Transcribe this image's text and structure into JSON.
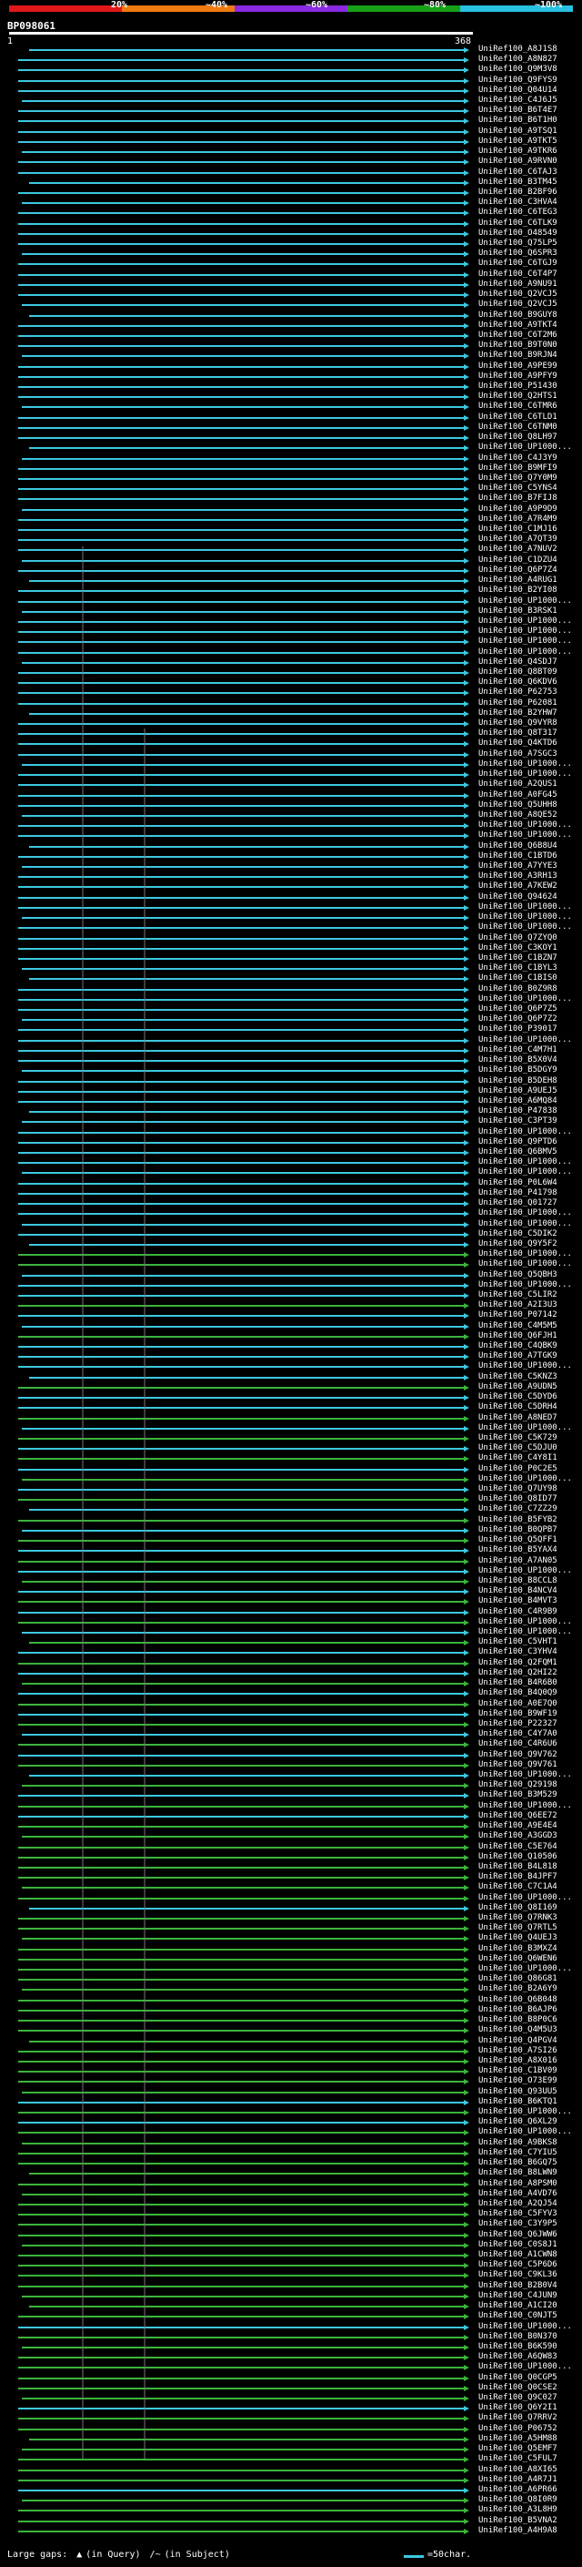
{
  "header": {
    "title": "BP098061",
    "scale_labels": [
      "20%",
      "~40%",
      "~60%",
      "~80%",
      "~100%"
    ],
    "scale_colors": [
      "#e01818",
      "#f07a10",
      "#8a2be2",
      "#18a018",
      "#2ac0e0"
    ],
    "query_start": "1",
    "query_end": "368"
  },
  "colors": {
    "high_identity": "#3cc8e0",
    "medium_identity": "#3cb43c",
    "gap_marker": "#777777"
  },
  "hits": [
    {
      "label": "UniRef100_A8J1S8",
      "color": "cyan"
    },
    {
      "label": "UniRef100_A8N827",
      "color": "cyan"
    },
    {
      "label": "UniRef100_Q9M3V8",
      "color": "cyan"
    },
    {
      "label": "UniRef100_Q9FYS9",
      "color": "cyan"
    },
    {
      "label": "UniRef100_Q04U14",
      "color": "cyan"
    },
    {
      "label": "UniRef100_C4J6J5",
      "color": "cyan"
    },
    {
      "label": "UniRef100_B6T4E7",
      "color": "cyan"
    },
    {
      "label": "UniRef100_B6T1H0",
      "color": "cyan"
    },
    {
      "label": "UniRef100_A9TSQ1",
      "color": "cyan"
    },
    {
      "label": "UniRef100_A9TKT5",
      "color": "cyan"
    },
    {
      "label": "UniRef100_A9TKR6",
      "color": "cyan"
    },
    {
      "label": "UniRef100_A9RVN0",
      "color": "cyan"
    },
    {
      "label": "UniRef100_C6TAJ3",
      "color": "cyan"
    },
    {
      "label": "UniRef100_B3TM45",
      "color": "cyan"
    },
    {
      "label": "UniRef100_B2BF96",
      "color": "cyan"
    },
    {
      "label": "UniRef100_C3HVA4",
      "color": "cyan"
    },
    {
      "label": "UniRef100_C6TEG3",
      "color": "cyan"
    },
    {
      "label": "UniRef100_C6TLK9",
      "color": "cyan"
    },
    {
      "label": "UniRef100_O48549",
      "color": "cyan"
    },
    {
      "label": "UniRef100_Q75LP5",
      "color": "cyan"
    },
    {
      "label": "UniRef100_Q6SPR3",
      "color": "cyan"
    },
    {
      "label": "UniRef100_C6TGJ9",
      "color": "cyan"
    },
    {
      "label": "UniRef100_C6T4P7",
      "color": "cyan"
    },
    {
      "label": "UniRef100_A9NU91",
      "color": "cyan"
    },
    {
      "label": "UniRef100_Q2VCJ5",
      "color": "cyan"
    },
    {
      "label": "UniRef100_Q2VCJ5",
      "color": "cyan"
    },
    {
      "label": "UniRef100_B9GUY8",
      "color": "cyan"
    },
    {
      "label": "UniRef100_A9TKT4",
      "color": "cyan"
    },
    {
      "label": "UniRef100_C6T2M6",
      "color": "cyan"
    },
    {
      "label": "UniRef100_B9T0N0",
      "color": "cyan"
    },
    {
      "label": "UniRef100_B9RJN4",
      "color": "cyan"
    },
    {
      "label": "UniRef100_A9PE99",
      "color": "cyan"
    },
    {
      "label": "UniRef100_A9PFY9",
      "color": "cyan"
    },
    {
      "label": "UniRef100_P51430",
      "color": "cyan"
    },
    {
      "label": "UniRef100_Q2HTS1",
      "color": "cyan"
    },
    {
      "label": "UniRef100_C6TMR6",
      "color": "cyan"
    },
    {
      "label": "UniRef100_C6TLD1",
      "color": "cyan"
    },
    {
      "label": "UniRef100_C6TNM0",
      "color": "cyan"
    },
    {
      "label": "UniRef100_Q8LH97",
      "color": "cyan"
    },
    {
      "label": "UniRef100_UP1000...",
      "color": "cyan"
    },
    {
      "label": "UniRef100_C4J3Y9",
      "color": "cyan"
    },
    {
      "label": "UniRef100_B9MFI9",
      "color": "cyan"
    },
    {
      "label": "UniRef100_Q7Y0M9",
      "color": "cyan"
    },
    {
      "label": "UniRef100_C5YNS4",
      "color": "cyan"
    },
    {
      "label": "UniRef100_B7FIJ8",
      "color": "cyan"
    },
    {
      "label": "UniRef100_A9P9D9",
      "color": "cyan"
    },
    {
      "label": "UniRef100_A7R4M9",
      "color": "cyan"
    },
    {
      "label": "UniRef100_C1MJ16",
      "color": "cyan"
    },
    {
      "label": "UniRef100_A7QT39",
      "color": "cyan"
    },
    {
      "label": "UniRef100_A7NUV2",
      "color": "cyan"
    },
    {
      "label": "UniRef100_C1DZU4",
      "color": "cyan"
    },
    {
      "label": "UniRef100_Q6P7Z4",
      "color": "cyan"
    },
    {
      "label": "UniRef100_A4RUG1",
      "color": "cyan"
    },
    {
      "label": "UniRef100_B2YI08",
      "color": "cyan"
    },
    {
      "label": "UniRef100_UP1000...",
      "color": "cyan"
    },
    {
      "label": "UniRef100_B3RSK1",
      "color": "cyan"
    },
    {
      "label": "UniRef100_UP1000...",
      "color": "cyan"
    },
    {
      "label": "UniRef100_UP1000...",
      "color": "cyan"
    },
    {
      "label": "UniRef100_UP1000...",
      "color": "cyan"
    },
    {
      "label": "UniRef100_UP1000...",
      "color": "cyan"
    },
    {
      "label": "UniRef100_Q4SDJ7",
      "color": "cyan"
    },
    {
      "label": "UniRef100_Q8BT09",
      "color": "cyan"
    },
    {
      "label": "UniRef100_Q6KDV6",
      "color": "cyan"
    },
    {
      "label": "UniRef100_P62753",
      "color": "cyan"
    },
    {
      "label": "UniRef100_P62081",
      "color": "cyan"
    },
    {
      "label": "UniRef100_B2YHW7",
      "color": "cyan"
    },
    {
      "label": "UniRef100_Q9VYR8",
      "color": "cyan"
    },
    {
      "label": "UniRef100_Q8T317",
      "color": "cyan"
    },
    {
      "label": "UniRef100_Q4KTD6",
      "color": "cyan"
    },
    {
      "label": "UniRef100_A7SGC3",
      "color": "cyan"
    },
    {
      "label": "UniRef100_UP1000...",
      "color": "cyan"
    },
    {
      "label": "UniRef100_UP1000...",
      "color": "cyan"
    },
    {
      "label": "UniRef100_A2QUS1",
      "color": "cyan"
    },
    {
      "label": "UniRef100_A0FG45",
      "color": "cyan"
    },
    {
      "label": "UniRef100_Q5UHH8",
      "color": "cyan"
    },
    {
      "label": "UniRef100_A8QE52",
      "color": "cyan"
    },
    {
      "label": "UniRef100_UP1000...",
      "color": "cyan"
    },
    {
      "label": "UniRef100_UP1000...",
      "color": "cyan"
    },
    {
      "label": "UniRef100_Q6B8U4",
      "color": "cyan"
    },
    {
      "label": "UniRef100_C1BTD6",
      "color": "cyan"
    },
    {
      "label": "UniRef100_A7YYE3",
      "color": "cyan"
    },
    {
      "label": "UniRef100_A3RH13",
      "color": "cyan"
    },
    {
      "label": "UniRef100_A7KEW2",
      "color": "cyan"
    },
    {
      "label": "UniRef100_Q94624",
      "color": "cyan"
    },
    {
      "label": "UniRef100_UP1000...",
      "color": "cyan"
    },
    {
      "label": "UniRef100_UP1000...",
      "color": "cyan"
    },
    {
      "label": "UniRef100_UP1000...",
      "color": "cyan"
    },
    {
      "label": "UniRef100_Q7ZYQ0",
      "color": "cyan"
    },
    {
      "label": "UniRef100_C3KOY1",
      "color": "cyan"
    },
    {
      "label": "UniRef100_C1BZN7",
      "color": "cyan"
    },
    {
      "label": "UniRef100_C1BYL3",
      "color": "cyan"
    },
    {
      "label": "UniRef100_C1BIS0",
      "color": "cyan"
    },
    {
      "label": "UniRef100_B0Z9R8",
      "color": "cyan"
    },
    {
      "label": "UniRef100_UP1000...",
      "color": "cyan"
    },
    {
      "label": "UniRef100_Q6P7Z5",
      "color": "cyan"
    },
    {
      "label": "UniRef100_Q6P7Z2",
      "color": "cyan"
    },
    {
      "label": "UniRef100_P39017",
      "color": "cyan"
    },
    {
      "label": "UniRef100_UP1000...",
      "color": "cyan"
    },
    {
      "label": "UniRef100_C4M7H1",
      "color": "cyan"
    },
    {
      "label": "UniRef100_B5X0V4",
      "color": "cyan"
    },
    {
      "label": "UniRef100_B5DGY9",
      "color": "cyan"
    },
    {
      "label": "UniRef100_B5DEH8",
      "color": "cyan"
    },
    {
      "label": "UniRef100_A9UEJ5",
      "color": "cyan"
    },
    {
      "label": "UniRef100_A6MQ84",
      "color": "cyan"
    },
    {
      "label": "UniRef100_P47838",
      "color": "cyan"
    },
    {
      "label": "UniRef100_C3PT39",
      "color": "cyan"
    },
    {
      "label": "UniRef100_UP1000...",
      "color": "cyan"
    },
    {
      "label": "UniRef100_Q9PTD6",
      "color": "cyan"
    },
    {
      "label": "UniRef100_Q6BMV5",
      "color": "cyan"
    },
    {
      "label": "UniRef100_UP1000...",
      "color": "cyan"
    },
    {
      "label": "UniRef100_UP1000...",
      "color": "cyan"
    },
    {
      "label": "UniRef100_P0L6W4",
      "color": "cyan"
    },
    {
      "label": "UniRef100_P41798",
      "color": "cyan"
    },
    {
      "label": "UniRef100_Q01727",
      "color": "cyan"
    },
    {
      "label": "UniRef100_UP1000...",
      "color": "cyan"
    },
    {
      "label": "UniRef100_UP1000...",
      "color": "cyan"
    },
    {
      "label": "UniRef100_C5DIK2",
      "color": "cyan"
    },
    {
      "label": "UniRef100_Q9Y5F2",
      "color": "cyan"
    },
    {
      "label": "UniRef100_UP1000...",
      "color": "green"
    },
    {
      "label": "UniRef100_UP1000...",
      "color": "green"
    },
    {
      "label": "UniRef100_Q5QBH3",
      "color": "cyan"
    },
    {
      "label": "UniRef100_UP1000...",
      "color": "cyan"
    },
    {
      "label": "UniRef100_C5LIR2",
      "color": "cyan"
    },
    {
      "label": "UniRef100_A2I3U3",
      "color": "green"
    },
    {
      "label": "UniRef100_P07142",
      "color": "cyan"
    },
    {
      "label": "UniRef100_C4M5M5",
      "color": "cyan"
    },
    {
      "label": "UniRef100_Q6FJH1",
      "color": "green"
    },
    {
      "label": "UniRef100_C4QBK9",
      "color": "cyan"
    },
    {
      "label": "UniRef100_A7TGK9",
      "color": "cyan"
    },
    {
      "label": "UniRef100_UP1000...",
      "color": "cyan"
    },
    {
      "label": "UniRef100_C5KNZ3",
      "color": "cyan"
    },
    {
      "label": "UniRef100_A9UDN5",
      "color": "green"
    },
    {
      "label": "UniRef100_C5DYD6",
      "color": "cyan"
    },
    {
      "label": "UniRef100_C5DRH4",
      "color": "cyan"
    },
    {
      "label": "UniRef100_A8NED7",
      "color": "green"
    },
    {
      "label": "UniRef100_UP1000...",
      "color": "cyan"
    },
    {
      "label": "UniRef100_C5K729",
      "color": "green"
    },
    {
      "label": "UniRef100_C5DJU0",
      "color": "cyan"
    },
    {
      "label": "UniRef100_C4Y8I1",
      "color": "green"
    },
    {
      "label": "UniRef100_P0C2E5",
      "color": "cyan"
    },
    {
      "label": "UniRef100_UP1000...",
      "color": "green"
    },
    {
      "label": "UniRef100_Q7UY98",
      "color": "cyan"
    },
    {
      "label": "UniRef100_Q8ID77",
      "color": "green"
    },
    {
      "label": "UniRef100_C7ZZ29",
      "color": "cyan"
    },
    {
      "label": "UniRef100_B5FYB2",
      "color": "green"
    },
    {
      "label": "UniRef100_B0QPB7",
      "color": "cyan"
    },
    {
      "label": "UniRef100_Q5QFF1",
      "color": "green"
    },
    {
      "label": "UniRef100_B5YAX4",
      "color": "cyan"
    },
    {
      "label": "UniRef100_A7AN05",
      "color": "green"
    },
    {
      "label": "UniRef100_UP1000...",
      "color": "cyan"
    },
    {
      "label": "UniRef100_B8CCL8",
      "color": "green"
    },
    {
      "label": "UniRef100_B4NCV4",
      "color": "cyan"
    },
    {
      "label": "UniRef100_B4MVT3",
      "color": "green"
    },
    {
      "label": "UniRef100_C4R9B9",
      "color": "cyan"
    },
    {
      "label": "UniRef100_UP1000...",
      "color": "green"
    },
    {
      "label": "UniRef100_UP1000...",
      "color": "cyan"
    },
    {
      "label": "UniRef100_C5VHT1",
      "color": "green"
    },
    {
      "label": "UniRef100_C3YHV4",
      "color": "cyan"
    },
    {
      "label": "UniRef100_Q2FQM1",
      "color": "green"
    },
    {
      "label": "UniRef100_Q2HI22",
      "color": "cyan"
    },
    {
      "label": "UniRef100_B4R6B0",
      "color": "green"
    },
    {
      "label": "UniRef100_B4Q0Q9",
      "color": "cyan"
    },
    {
      "label": "UniRef100_A0E7Q0",
      "color": "green"
    },
    {
      "label": "UniRef100_B9WF19",
      "color": "cyan"
    },
    {
      "label": "UniRef100_P22327",
      "color": "green"
    },
    {
      "label": "UniRef100_C4Y7A0",
      "color": "cyan"
    },
    {
      "label": "UniRef100_C4R6U6",
      "color": "green"
    },
    {
      "label": "UniRef100_Q9V762",
      "color": "cyan"
    },
    {
      "label": "UniRef100_Q9V761",
      "color": "green"
    },
    {
      "label": "UniRef100_UP1000...",
      "color": "cyan"
    },
    {
      "label": "UniRef100_Q29198",
      "color": "green"
    },
    {
      "label": "UniRef100_B3M529",
      "color": "cyan"
    },
    {
      "label": "UniRef100_UP1000...",
      "color": "green"
    },
    {
      "label": "UniRef100_Q6EE72",
      "color": "cyan"
    },
    {
      "label": "UniRef100_A9E4E4",
      "color": "green"
    },
    {
      "label": "UniRef100_A3GGD3",
      "color": "green"
    },
    {
      "label": "UniRef100_C5E764",
      "color": "green"
    },
    {
      "label": "UniRef100_Q10506",
      "color": "green"
    },
    {
      "label": "UniRef100_B4L818",
      "color": "green"
    },
    {
      "label": "UniRef100_B4JPF7",
      "color": "green"
    },
    {
      "label": "UniRef100_C7C1A4",
      "color": "green"
    },
    {
      "label": "UniRef100_UP1000...",
      "color": "green"
    },
    {
      "label": "UniRef100_Q8I169",
      "color": "cyan"
    },
    {
      "label": "UniRef100_Q7RNK3",
      "color": "green"
    },
    {
      "label": "UniRef100_Q7RTL5",
      "color": "green"
    },
    {
      "label": "UniRef100_Q4UEJ3",
      "color": "green"
    },
    {
      "label": "UniRef100_B3MXZ4",
      "color": "green"
    },
    {
      "label": "UniRef100_Q6WEN6",
      "color": "green"
    },
    {
      "label": "UniRef100_UP1000...",
      "color": "green"
    },
    {
      "label": "UniRef100_Q86G81",
      "color": "green"
    },
    {
      "label": "UniRef100_B2A6Y9",
      "color": "green"
    },
    {
      "label": "UniRef100_Q6B048",
      "color": "green"
    },
    {
      "label": "UniRef100_B6AJP6",
      "color": "green"
    },
    {
      "label": "UniRef100_B8P0C6",
      "color": "green"
    },
    {
      "label": "UniRef100_Q4M5U3",
      "color": "green"
    },
    {
      "label": "UniRef100_Q4PGV4",
      "color": "green"
    },
    {
      "label": "UniRef100_A7SI26",
      "color": "green"
    },
    {
      "label": "UniRef100_A8X016",
      "color": "green"
    },
    {
      "label": "UniRef100_C1BV09",
      "color": "green"
    },
    {
      "label": "UniRef100_O73E99",
      "color": "green"
    },
    {
      "label": "UniRef100_Q93UU5",
      "color": "green"
    },
    {
      "label": "UniRef100_B6KTQ1",
      "color": "cyan"
    },
    {
      "label": "UniRef100_UP1000...",
      "color": "green"
    },
    {
      "label": "UniRef100_Q6XL29",
      "color": "cyan"
    },
    {
      "label": "UniRef100_UP1000...",
      "color": "green"
    },
    {
      "label": "UniRef100_A9BKS8",
      "color": "green"
    },
    {
      "label": "UniRef100_C7YIU5",
      "color": "green"
    },
    {
      "label": "UniRef100_B6GQ75",
      "color": "green"
    },
    {
      "label": "UniRef100_B8LWN9",
      "color": "green"
    },
    {
      "label": "UniRef100_A8PSM0",
      "color": "green"
    },
    {
      "label": "UniRef100_A4VD76",
      "color": "green"
    },
    {
      "label": "UniRef100_A2QJ54",
      "color": "green"
    },
    {
      "label": "UniRef100_C5FYV3",
      "color": "green"
    },
    {
      "label": "UniRef100_C3Y9P5",
      "color": "green"
    },
    {
      "label": "UniRef100_Q6JWW6",
      "color": "green"
    },
    {
      "label": "UniRef100_C0S8J1",
      "color": "green"
    },
    {
      "label": "UniRef100_A1CWN8",
      "color": "green"
    },
    {
      "label": "UniRef100_C5P6D6",
      "color": "green"
    },
    {
      "label": "UniRef100_C9KL36",
      "color": "green"
    },
    {
      "label": "UniRef100_B2B0V4",
      "color": "green"
    },
    {
      "label": "UniRef100_C4JUN9",
      "color": "green"
    },
    {
      "label": "UniRef100_A1CI20",
      "color": "green"
    },
    {
      "label": "UniRef100_C0NJT5",
      "color": "green"
    },
    {
      "label": "UniRef100_UP1000...",
      "color": "cyan"
    },
    {
      "label": "UniRef100_B0N370",
      "color": "green"
    },
    {
      "label": "UniRef100_B6K590",
      "color": "green"
    },
    {
      "label": "UniRef100_A6QW83",
      "color": "green"
    },
    {
      "label": "UniRef100_UP1000...",
      "color": "green"
    },
    {
      "label": "UniRef100_Q0CGP5",
      "color": "green"
    },
    {
      "label": "UniRef100_Q0CSE2",
      "color": "green"
    },
    {
      "label": "UniRef100_Q9C027",
      "color": "green"
    },
    {
      "label": "UniRef100_Q6Y2I1",
      "color": "cyan"
    },
    {
      "label": "UniRef100_Q7RRV2",
      "color": "green"
    },
    {
      "label": "UniRef100_P06752",
      "color": "green"
    },
    {
      "label": "UniRef100_A5HM88",
      "color": "green"
    },
    {
      "label": "UniRef100_Q5EMF7",
      "color": "green"
    },
    {
      "label": "UniRef100_C5FUL7",
      "color": "green"
    },
    {
      "label": "UniRef100_A8XI65",
      "color": "green"
    },
    {
      "label": "UniRef100_A4R7J1",
      "color": "green"
    },
    {
      "label": "UniRef100_A6PR66",
      "color": "cyan"
    },
    {
      "label": "UniRef100_Q8I0R9",
      "color": "green"
    },
    {
      "label": "UniRef100_A3L8H9",
      "color": "green"
    },
    {
      "label": "UniRef100_B5VNA2",
      "color": "green"
    },
    {
      "label": "UniRef100_A4H9A8",
      "color": "green"
    }
  ],
  "footer": {
    "gap_label": "Large gaps:",
    "query_gap_label": "(in Query)",
    "subject_gap_label": "(in Subject)",
    "char_scale_label": "=50char."
  }
}
